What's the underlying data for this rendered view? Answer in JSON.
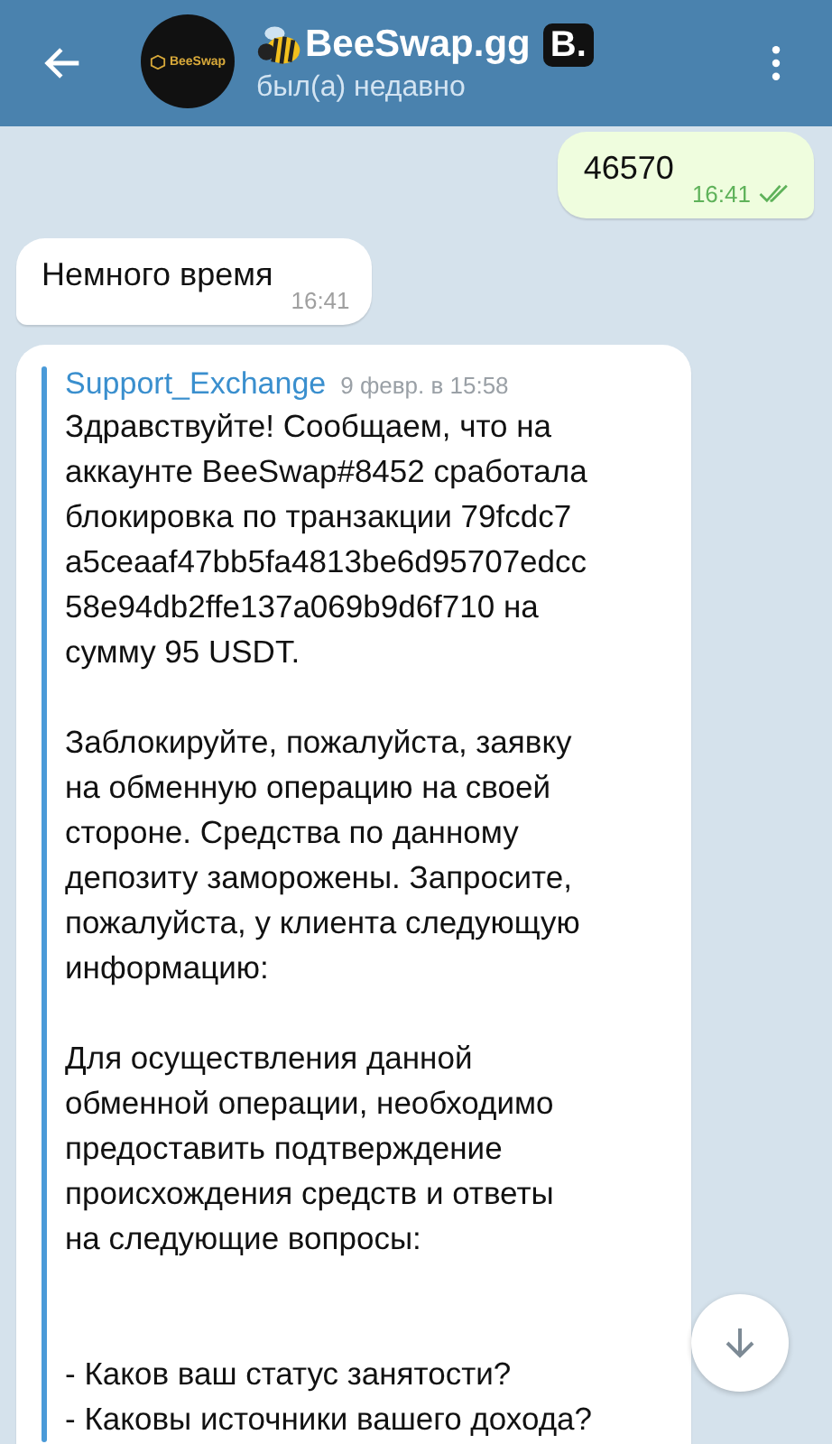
{
  "header": {
    "title": "BeeSwap.gg",
    "badge": "B.",
    "status": "был(а) недавно",
    "avatar_text": "BeeSwap"
  },
  "messages": [
    {
      "kind": "outgoing",
      "text": "46570",
      "time": "16:41",
      "read": true
    },
    {
      "kind": "incoming",
      "text": "Немного время",
      "time": "16:41"
    },
    {
      "kind": "forwarded",
      "sender": "Support_Exchange",
      "date": "9 февр. в 15:58",
      "text": "Здравствуйте! Сообщаем, что на\nаккаунте BeeSwap#8452 сработала\nблокировка по транзакции 79fcdc7\na5ceaaf47bb5fa4813be6d95707edcc\n58e94db2ffe137a069b9d6f710 на\nсумму 95 USDT.\n\nЗаблокируйте, пожалуйста, заявку\nна обменную операцию на своей\nстороне. Средства по данному\nдепозиту заморожены. Запросите,\nпожалуйста, у клиента следующую\nинформацию:\n\nДля осуществления данной\nобменной операции, необходимо\nпредоставить подтверждение\nпроисхождения средств и ответы\nна следующие вопросы:\n\n\n- Каков ваш статус занятости?\n- Каковы источники вашего дохода?"
    }
  ]
}
